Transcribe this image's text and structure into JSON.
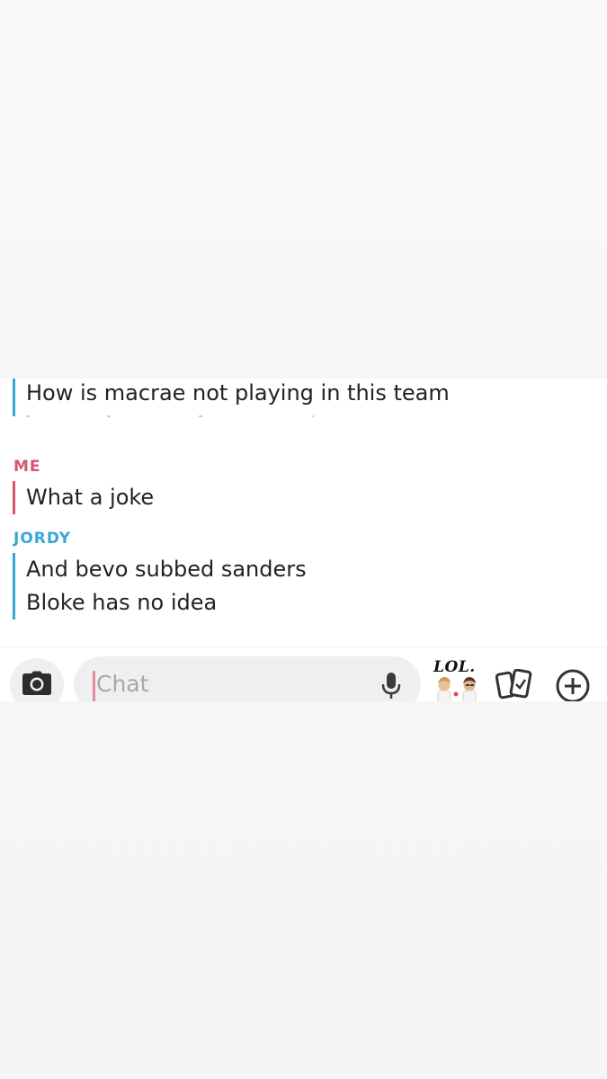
{
  "messages": {
    "first_line": "How is macrae not playing in this team",
    "me_group": {
      "sender": "ME",
      "lines": [
        "What a joke"
      ]
    },
    "jordy_group": {
      "sender": "JORDY",
      "lines": [
        "And bevo subbed sanders",
        "Bloke has no idea"
      ]
    }
  },
  "colors": {
    "me": "#d6546e",
    "jordy": "#3aa6d9"
  },
  "toolbar": {
    "chat_placeholder": "Chat",
    "bitmoji_caption": "LOL.",
    "icons": [
      "camera-icon",
      "microphone-icon",
      "bitmoji-sticker-icon",
      "cards-icon",
      "plus-icon"
    ]
  }
}
